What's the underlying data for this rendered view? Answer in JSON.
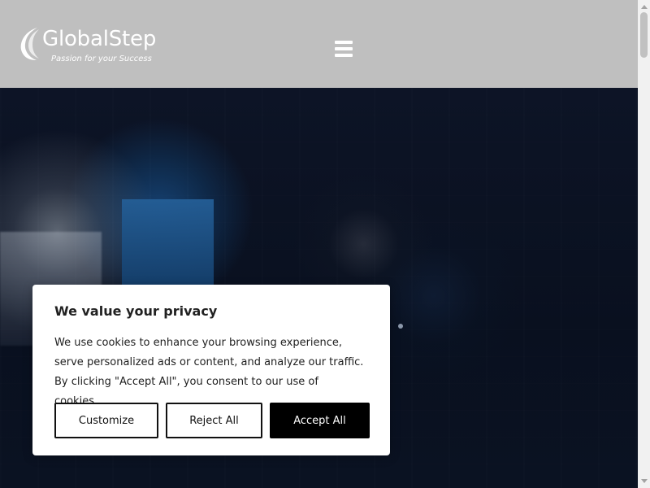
{
  "header": {
    "brand_name": "GlobalStep",
    "tagline": "Passion for your Success",
    "menu_icon": "hamburger-menu-icon"
  },
  "hero": {
    "background": "dark-abstract-office"
  },
  "cookie_banner": {
    "title": "We value your privacy",
    "body_line_1": "We use cookies to enhance your browsing experience,",
    "body_line_2": "serve personalized ads or content, and analyze our traffic.",
    "body_line_3": "By clicking \"Accept All\", you consent to our use of cookies.",
    "customize_label": "Customize",
    "reject_label": "Reject All",
    "accept_label": "Accept All"
  },
  "scrollbar": {
    "up_icon": "scroll-up-arrow-icon",
    "down_icon": "scroll-down-arrow-icon"
  },
  "colors": {
    "header_bg": "#bfbfbf",
    "hero_bg": "#0b1220",
    "dialog_bg": "#ffffff",
    "primary_button_bg": "#000000",
    "text_dark": "#212121"
  }
}
